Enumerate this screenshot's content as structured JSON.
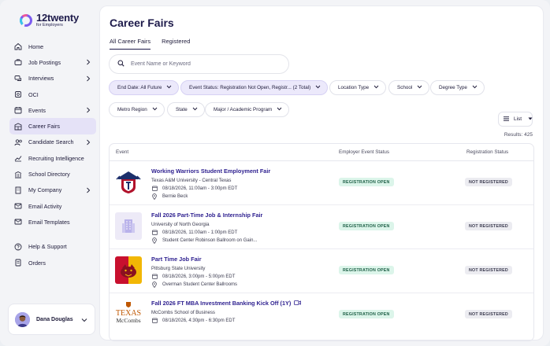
{
  "brand": {
    "name": "12twenty",
    "sub": "for Employers"
  },
  "sidebar": {
    "items": [
      {
        "label": "Home",
        "icon": "home-icon",
        "chevron": false
      },
      {
        "label": "Job Postings",
        "icon": "briefcase-icon",
        "chevron": true
      },
      {
        "label": "Interviews",
        "icon": "chat-icon",
        "chevron": true
      },
      {
        "label": "OCI",
        "icon": "oci-icon",
        "chevron": false
      },
      {
        "label": "Events",
        "icon": "calendar-icon",
        "chevron": true
      },
      {
        "label": "Career Fairs",
        "icon": "career-fair-icon",
        "chevron": false,
        "active": true
      },
      {
        "label": "Candidate Search",
        "icon": "users-icon",
        "chevron": true
      },
      {
        "label": "Recruiting Intelligence",
        "icon": "chart-icon",
        "chevron": false
      },
      {
        "label": "School Directory",
        "icon": "school-icon",
        "chevron": false
      },
      {
        "label": "My Company",
        "icon": "building-icon",
        "chevron": true
      },
      {
        "label": "Email Activity",
        "icon": "email-icon",
        "chevron": false
      },
      {
        "label": "Email Templates",
        "icon": "email-template-icon",
        "chevron": false
      }
    ],
    "bottom_items": [
      {
        "label": "Help & Support",
        "icon": "help-icon"
      },
      {
        "label": "Orders",
        "icon": "orders-icon"
      }
    ],
    "user": {
      "name": "Dana Douglas"
    }
  },
  "main": {
    "title": "Career Fairs",
    "tabs": [
      {
        "label": "All Career Fairs",
        "active": true
      },
      {
        "label": "Registered",
        "active": false
      }
    ],
    "search": {
      "placeholder": "Event Name or Keyword",
      "value": ""
    },
    "filters_row1": [
      {
        "label": "End Date: All Future",
        "selected": true
      },
      {
        "label": "Event Status: Registration Not Open, Registr... (2 Total)",
        "selected": true
      },
      {
        "label": "Location Type",
        "selected": false
      },
      {
        "label": "School",
        "selected": false
      },
      {
        "label": "Degree Type",
        "selected": false
      }
    ],
    "filters_row2": [
      {
        "label": "Metro Region",
        "selected": false
      },
      {
        "label": "State",
        "selected": false
      },
      {
        "label": "Major / Academic Program",
        "selected": false
      }
    ],
    "view": {
      "label": "List"
    },
    "results": "Results: 425",
    "table": {
      "headers": [
        "Event",
        "Employer Event Status",
        "Registration Status"
      ],
      "rows": [
        {
          "title": "Working Warriors Student Employment Fair",
          "org": "Texas A&M University - Central Texas",
          "datetime": "08/18/2026, 11:00am - 3:00pm EDT",
          "location": "Bernie Beck",
          "employer_status": "REGISTRATION OPEN",
          "registration_status": "NOT REGISTERED",
          "thumb": "tamuct-logo"
        },
        {
          "title": "Fall 2026 Part-Time Job & Internship Fair",
          "org": "University of North Georgia",
          "datetime": "08/18/2026, 11:00am - 1:00pm EDT",
          "location": "Student Center Robinson Ballroom on Gain...",
          "employer_status": "REGISTRATION OPEN",
          "registration_status": "NOT REGISTERED",
          "thumb": "building-placeholder"
        },
        {
          "title": "Part Time Job Fair",
          "org": "Pittsburg State University",
          "datetime": "08/18/2026, 3:00pm - 5:00pm EDT",
          "location": "Overman Student Center Ballrooms",
          "employer_status": "REGISTRATION OPEN",
          "registration_status": "NOT REGISTERED",
          "thumb": "pittsburg-state-logo"
        },
        {
          "title": "Fall 2026 FT MBA Investment Banking Kick Off (1Y)",
          "org": "McCombs School of Business",
          "datetime": "08/18/2026, 4:30pm - 6:30pm EDT",
          "location": "",
          "employer_status": "REGISTRATION OPEN",
          "registration_status": "NOT REGISTERED",
          "thumb": "texas-mccombs-logo",
          "virtual": true
        }
      ]
    }
  },
  "logos": {
    "texas_mccombs": [
      "TEXAS",
      "McCombs"
    ]
  },
  "colors": {
    "accent": "#2d1f8f",
    "active_nav": "#e5e2f7",
    "open_badge_bg": "#dcf5ea",
    "open_badge_text": "#1c5e45"
  }
}
